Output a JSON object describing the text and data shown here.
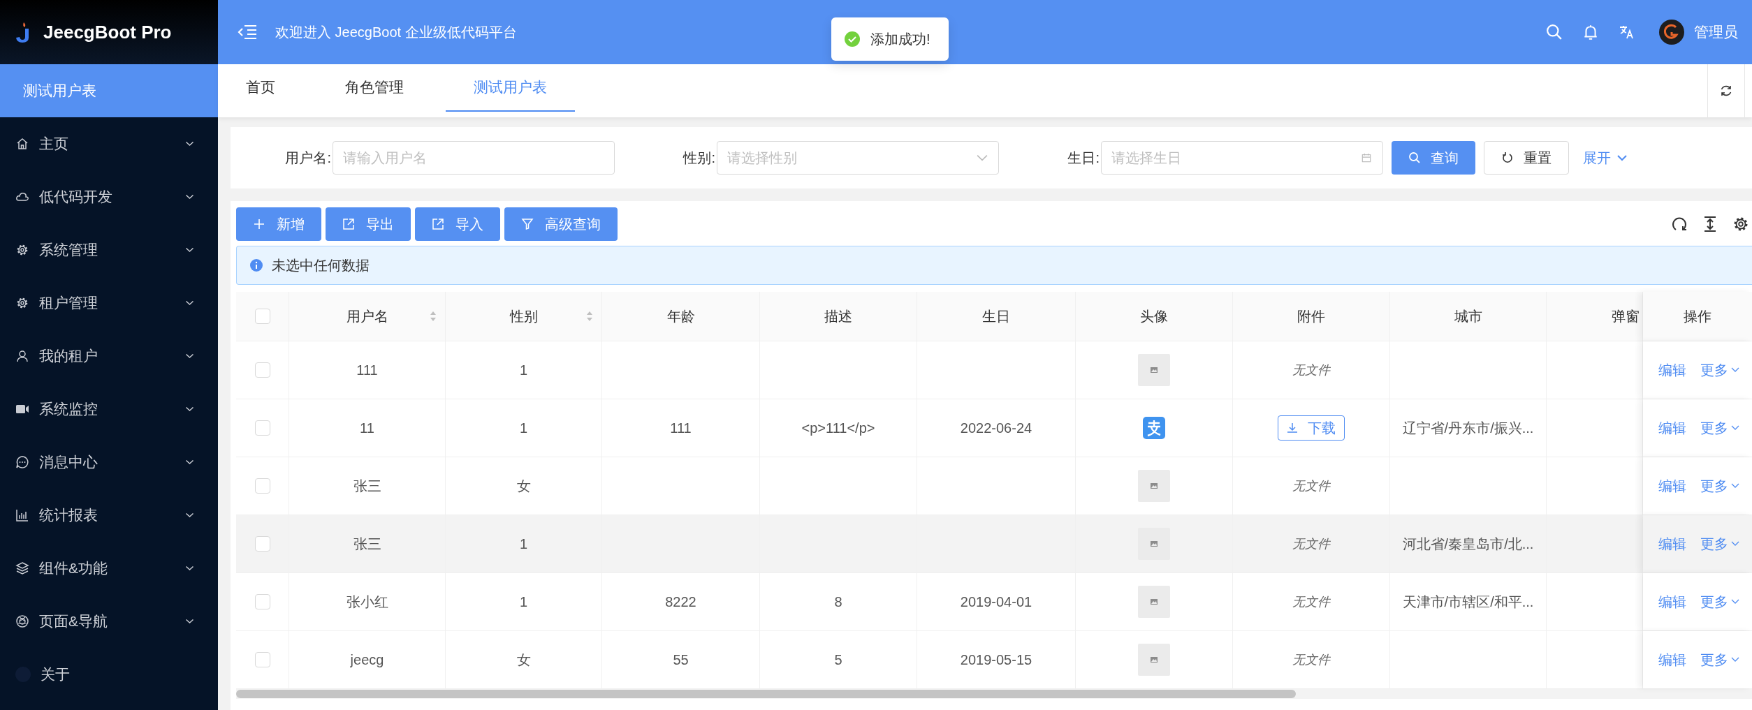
{
  "brand": {
    "name": "JeecgBoot Pro"
  },
  "sidebar": {
    "items": [
      {
        "label": "测试用户表",
        "selected": true,
        "submenu": false
      },
      {
        "label": "主页",
        "selected": false,
        "submenu": true
      },
      {
        "label": "低代码开发",
        "selected": false,
        "submenu": true
      },
      {
        "label": "系统管理",
        "selected": false,
        "submenu": true
      },
      {
        "label": "租户管理",
        "selected": false,
        "submenu": true
      },
      {
        "label": "我的租户",
        "selected": false,
        "submenu": true
      },
      {
        "label": "系统监控",
        "selected": false,
        "submenu": true
      },
      {
        "label": "消息中心",
        "selected": false,
        "submenu": true
      },
      {
        "label": "统计报表",
        "selected": false,
        "submenu": true
      },
      {
        "label": "组件&功能",
        "selected": false,
        "submenu": true
      },
      {
        "label": "页面&导航",
        "selected": false,
        "submenu": true
      },
      {
        "label": "关于",
        "selected": false,
        "submenu": false
      }
    ]
  },
  "header": {
    "title": "欢迎进入 JeecgBoot 企业级低代码平台",
    "user": "管理员"
  },
  "toast": {
    "message": "添加成功!"
  },
  "tabs": [
    {
      "label": "首页",
      "selected": false
    },
    {
      "label": "角色管理",
      "selected": false
    },
    {
      "label": "测试用户表",
      "selected": true
    }
  ],
  "filters": [
    {
      "label": "用户名:",
      "placeholder": "请输入用户名",
      "kind": "text"
    },
    {
      "label": "性别:",
      "placeholder": "请选择性别",
      "kind": "select"
    },
    {
      "label": "生日:",
      "placeholder": "请选择生日",
      "kind": "date"
    }
  ],
  "filter_buttons": {
    "search": "查询",
    "reset": "重置",
    "expand": "展开"
  },
  "toolbar": {
    "buttons": [
      {
        "label": "新增",
        "kind": "add"
      },
      {
        "label": "导出",
        "kind": "export"
      },
      {
        "label": "导入",
        "kind": "import"
      },
      {
        "label": "高级查询",
        "kind": "filter"
      }
    ]
  },
  "alert": {
    "message": "未选中任何数据"
  },
  "table": {
    "all_checked": false,
    "columns": [
      {
        "label": "用户名",
        "sortable": true
      },
      {
        "label": "性别",
        "sortable": true
      },
      {
        "label": "年龄",
        "sortable": false
      },
      {
        "label": "描述",
        "sortable": false
      },
      {
        "label": "生日",
        "sortable": false
      },
      {
        "label": "头像",
        "sortable": false
      },
      {
        "label": "附件",
        "sortable": false
      },
      {
        "label": "城市",
        "sortable": false
      },
      {
        "label": "弹窗",
        "sortable": false
      },
      {
        "label": "操作",
        "sortable": false
      }
    ],
    "rows": [
      {
        "checked": false,
        "highlighted": false,
        "name": "111",
        "gender": "1",
        "avatar": {
          "kind": "placeholder"
        },
        "file": {
          "kind": "none",
          "text": "无文件"
        },
        "edit": "编辑",
        "more": "更多"
      },
      {
        "checked": false,
        "highlighted": false,
        "name": "11",
        "gender": "1",
        "age": "111",
        "description": "<p>111</p>",
        "birthday": "2022-06-24",
        "avatar": {
          "kind": "logo"
        },
        "file": {
          "kind": "download",
          "text": "下载"
        },
        "city": "辽宁省/丹东市/振兴...",
        "edit": "编辑",
        "more": "更多"
      },
      {
        "checked": false,
        "highlighted": false,
        "name": "张三",
        "gender": "女",
        "avatar": {
          "kind": "placeholder"
        },
        "file": {
          "kind": "none",
          "text": "无文件"
        },
        "edit": "编辑",
        "more": "更多"
      },
      {
        "checked": false,
        "highlighted": true,
        "name": "张三",
        "gender": "1",
        "avatar": {
          "kind": "placeholder"
        },
        "file": {
          "kind": "none",
          "text": "无文件"
        },
        "city": "河北省/秦皇岛市/北...",
        "edit": "编辑",
        "more": "更多"
      },
      {
        "checked": false,
        "highlighted": false,
        "name": "张小红",
        "gender": "1",
        "age": "8222",
        "description": "8",
        "birthday": "2019-04-01",
        "avatar": {
          "kind": "placeholder"
        },
        "file": {
          "kind": "none",
          "text": "无文件"
        },
        "city": "天津市/市辖区/和平...",
        "edit": "编辑",
        "more": "更多"
      },
      {
        "checked": false,
        "highlighted": false,
        "name": "jeecg",
        "gender": "女",
        "age": "55",
        "description": "5",
        "birthday": "2019-05-15",
        "avatar": {
          "kind": "placeholder"
        },
        "file": {
          "kind": "none",
          "text": "无文件"
        },
        "edit": "编辑",
        "more": "更多"
      }
    ]
  }
}
